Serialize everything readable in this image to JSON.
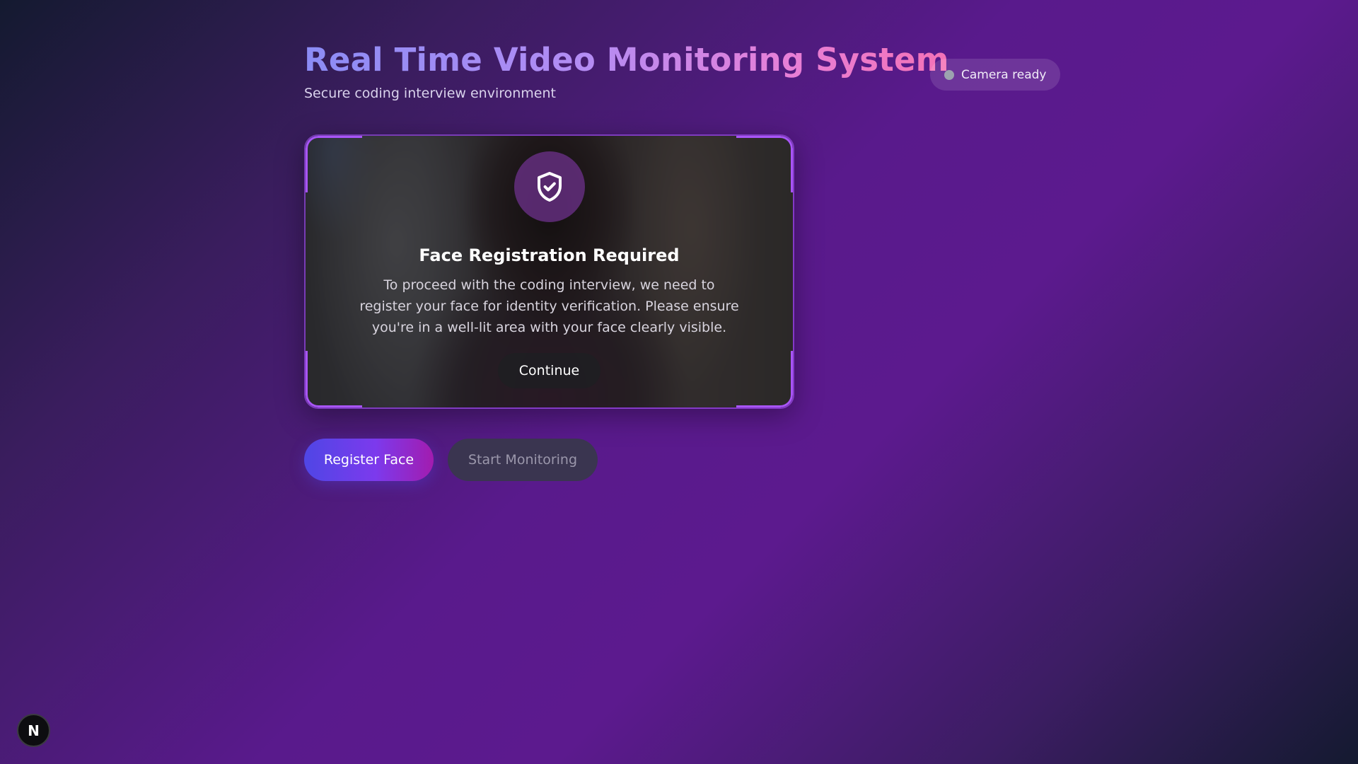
{
  "header": {
    "title": "Real Time Video Monitoring System",
    "subtitle": "Secure coding interview environment"
  },
  "status": {
    "label": "Camera ready",
    "dot_color": "#9ca3af"
  },
  "video": {
    "frame_color": "#a855f7",
    "modal": {
      "icon": "shield-check-icon",
      "title": "Face Registration Required",
      "text": "To proceed with the coding interview, we need to register your face for identity verification. Please ensure you're in a well-lit area with your face clearly visible.",
      "button_label": "Continue"
    }
  },
  "actions": {
    "register_label": "Register Face",
    "start_label": "Start Monitoring"
  },
  "dev_badge": {
    "letter": "N"
  }
}
